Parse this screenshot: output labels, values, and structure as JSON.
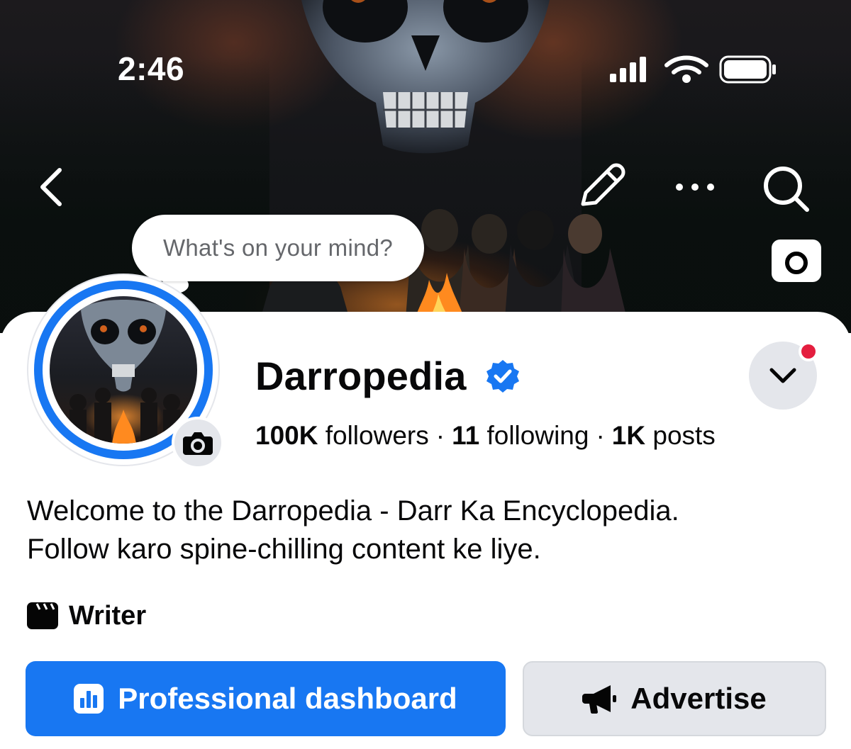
{
  "status_bar": {
    "time": "2:46",
    "icons": [
      "signal-icon",
      "wifi-icon",
      "battery-icon"
    ]
  },
  "cover_nav": {
    "icons": [
      "back-icon",
      "edit-icon",
      "more-icon",
      "search-icon",
      "camera-icon"
    ]
  },
  "composer": {
    "placeholder": "What's on your mind?"
  },
  "profile": {
    "name": "Darropedia",
    "verified_icon": "verified-badge-icon",
    "stats": {
      "followers_count": "100K",
      "followers_label": "followers",
      "following_count": "11",
      "following_label": "following",
      "posts_count": "1K",
      "posts_label": "posts",
      "separator": "·"
    },
    "bio_line1": "Welcome to the Darropedia - Darr Ka Encyclopedia.",
    "bio_line2": "Follow karo spine-chilling content ke liye.",
    "role": "Writer",
    "role_icon": "clapperboard-icon"
  },
  "actions": {
    "dashboard_label": "Professional dashboard",
    "advertise_label": "Advertise"
  },
  "colors": {
    "accent": "#1877f2",
    "button_gray": "#e4e6eb",
    "notification_dot": "#e41e3f",
    "secondary_text": "#65676b"
  }
}
